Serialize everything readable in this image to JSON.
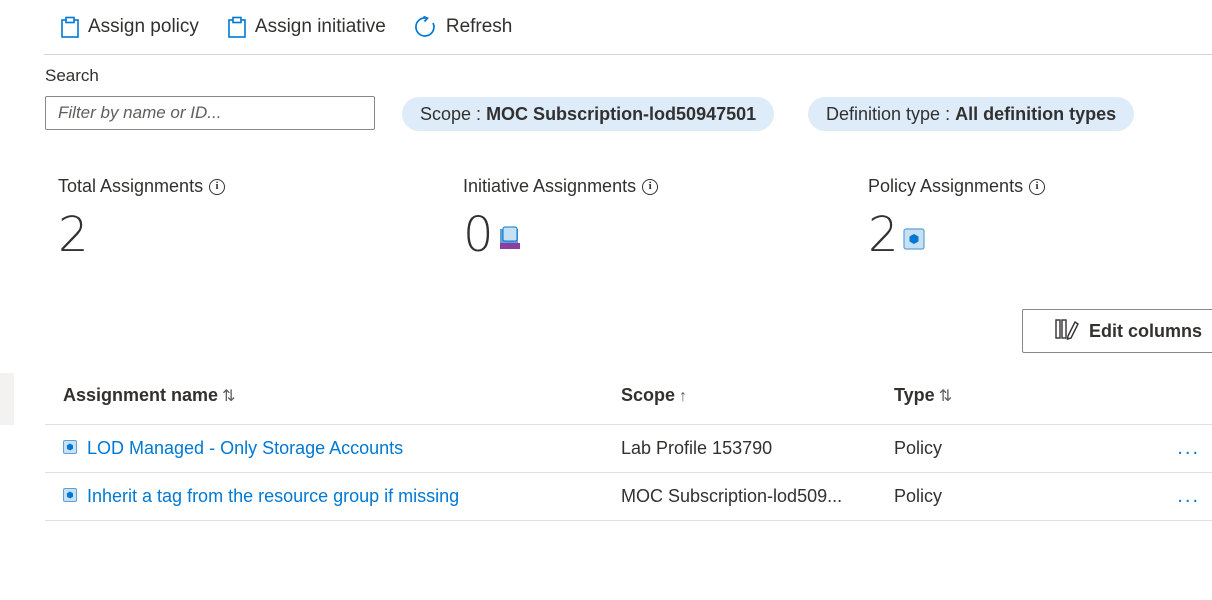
{
  "toolbar": {
    "assign_policy": "Assign policy",
    "assign_initiative": "Assign initiative",
    "refresh": "Refresh"
  },
  "search": {
    "label": "Search",
    "placeholder": "Filter by name or ID..."
  },
  "filters": {
    "scope_label": "Scope :",
    "scope_value": "MOC Subscription-lod50947501",
    "definition_label": "Definition type :",
    "definition_value": "All definition types"
  },
  "stats": {
    "total_label": "Total Assignments",
    "total_value": "2",
    "initiative_label": "Initiative Assignments",
    "initiative_value": "0",
    "policy_label": "Policy Assignments",
    "policy_value": "2"
  },
  "edit_columns_label": "Edit columns",
  "table": {
    "headers": {
      "name": "Assignment name",
      "scope": "Scope",
      "type": "Type"
    },
    "sort_icons": {
      "name": "⇅",
      "scope": "↑",
      "type": "⇅"
    },
    "rows": [
      {
        "name": "LOD Managed - Only Storage Accounts",
        "scope": "Lab Profile 153790",
        "type": "Policy",
        "more": "..."
      },
      {
        "name": "Inherit a tag from the resource group if missing",
        "scope": "MOC Subscription-lod509...",
        "type": "Policy",
        "more": "..."
      }
    ]
  },
  "colors": {
    "accent": "#0078d4",
    "pill_bg": "#deecf9",
    "icon_purple": "#8b3fa0"
  }
}
